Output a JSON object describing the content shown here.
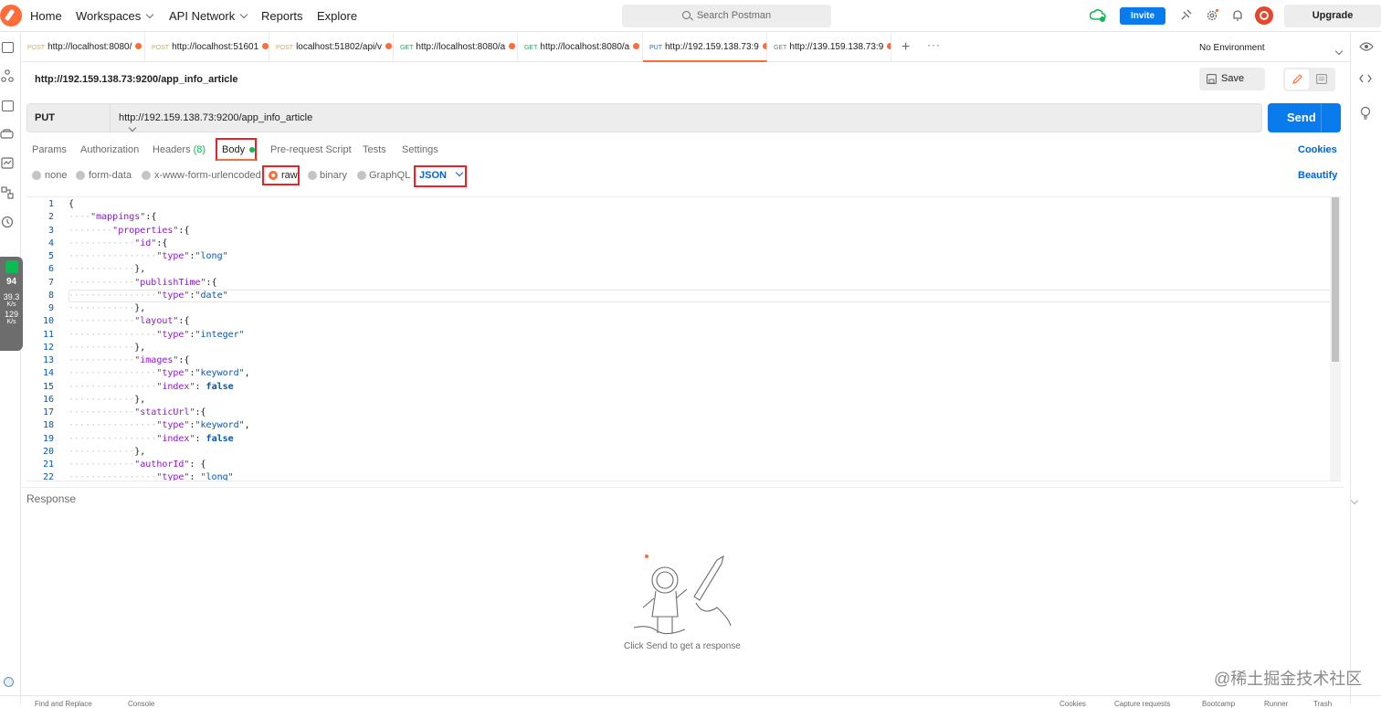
{
  "topbar": {
    "nav": [
      "Home",
      "Workspaces",
      "API Network",
      "Reports",
      "Explore"
    ],
    "search_placeholder": "Search Postman",
    "invite_label": "Invite",
    "upgrade_label": "Upgrade"
  },
  "tabs": [
    {
      "method": "POST",
      "label": "http://localhost:8080/",
      "method_color": "#f5a623"
    },
    {
      "method": "POST",
      "label": "http://localhost:51601",
      "method_color": "#f5a623"
    },
    {
      "method": "POST",
      "label": "localhost:51802/api/v",
      "method_color": "#f5a623"
    },
    {
      "method": "GET",
      "label": "http://localhost:8080/a",
      "method_color": "#0cbb52"
    },
    {
      "method": "GET",
      "label": "http://localhost:8080/a",
      "method_color": "#0cbb52"
    },
    {
      "method": "PUT",
      "label": "http://192.159.138.73:9",
      "method_color": "#097bed"
    },
    {
      "method": "GET",
      "label": "http://139.159.138.73:9",
      "method_color": "#0cbb52"
    }
  ],
  "environment": "No Environment",
  "request": {
    "title": "http://192.159.138.73:9200/app_info_article",
    "save_label": "Save",
    "method": "PUT",
    "url": "http://192.159.138.73:9200/app_info_article",
    "send_label": "Send"
  },
  "request_tabs": {
    "params": "Params",
    "authorization": "Authorization",
    "headers": "Headers",
    "headers_count": "(8)",
    "body": "Body",
    "prerequest": "Pre-request Script",
    "tests": "Tests",
    "settings": "Settings",
    "cookies": "Cookies"
  },
  "body_types": {
    "none": "none",
    "form_data": "form-data",
    "urlencoded": "x-www-form-urlencoded",
    "raw": "raw",
    "binary": "binary",
    "graphql": "GraphQL",
    "format": "JSON",
    "beautify": "Beautify"
  },
  "code_lines": [
    "{",
    "    \"mappings\":{",
    "        \"properties\":{",
    "            \"id\":{",
    "                \"type\":\"long\"",
    "            },",
    "            \"publishTime\":{",
    "                \"type\":\"date\"",
    "            },",
    "            \"layout\":{",
    "                \"type\":\"integer\"",
    "            },",
    "            \"images\":{",
    "                \"type\":\"keyword\",",
    "                \"index\": false",
    "            },",
    "            \"staticUrl\":{",
    "                \"type\":\"keyword\",",
    "                \"index\": false",
    "            },",
    "            \"authorId\": {",
    "                \"type\": \"long\""
  ],
  "response": {
    "label": "Response",
    "hint": "Click Send to get a response"
  },
  "perf_widget": {
    "percent": "94",
    "up": "39.3",
    "up_unit": "K/s",
    "down": "129",
    "down_unit": "K/s"
  },
  "watermark": "@稀土掘金技术社区",
  "status_bar": [
    "Find and Replace",
    "Console",
    "Cookies",
    "Capture requests",
    "Bootcamp",
    "Runner",
    "Trash"
  ]
}
